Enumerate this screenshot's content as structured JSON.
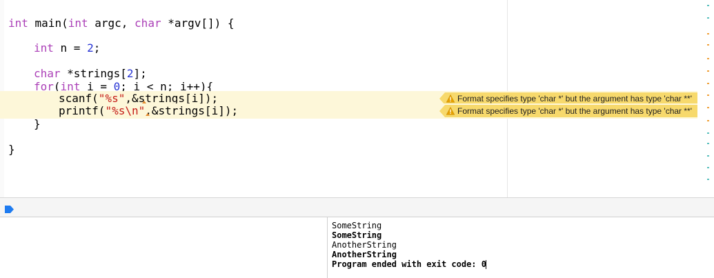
{
  "editor": {
    "code_lines": [
      {
        "segments": [
          {
            "t": "int",
            "c": "kw"
          },
          {
            "t": " main(",
            "c": ""
          },
          {
            "t": "int",
            "c": "kw"
          },
          {
            "t": " argc, ",
            "c": ""
          },
          {
            "t": "char",
            "c": "kw"
          },
          {
            "t": " *argv[]) {",
            "c": ""
          }
        ]
      },
      {
        "segments": [
          {
            "t": "int",
            "c": "kw"
          },
          {
            "t": " n = ",
            "c": ""
          },
          {
            "t": "2",
            "c": "num"
          },
          {
            "t": ";",
            "c": ""
          }
        ]
      },
      {
        "segments": [
          {
            "t": "char",
            "c": "kw"
          },
          {
            "t": " *strings[",
            "c": ""
          },
          {
            "t": "2",
            "c": "num"
          },
          {
            "t": "];",
            "c": ""
          }
        ]
      },
      {
        "segments": [
          {
            "t": "for",
            "c": "kw"
          },
          {
            "t": "(",
            "c": ""
          },
          {
            "t": "int",
            "c": "kw"
          },
          {
            "t": " i = ",
            "c": ""
          },
          {
            "t": "0",
            "c": "num"
          },
          {
            "t": "; i < n; i++){",
            "c": ""
          }
        ]
      },
      {
        "segments": [
          {
            "t": "scanf(",
            "c": ""
          },
          {
            "t": "\"%s\"",
            "c": "str"
          },
          {
            "t": ",&strings[i]);",
            "c": ""
          }
        ]
      },
      {
        "segments": [
          {
            "t": "printf(",
            "c": ""
          },
          {
            "t": "\"%s\\n\"",
            "c": "str"
          },
          {
            "t": ",&strings[i]);",
            "c": ""
          }
        ]
      },
      {
        "segments": [
          {
            "t": "}",
            "c": ""
          }
        ]
      },
      {
        "segments": [
          {
            "t": "}",
            "c": ""
          }
        ]
      }
    ],
    "warnings": [
      {
        "icon": "warning-triangle-icon",
        "message": "Format specifies type 'char *' but the argument has type 'char **'"
      },
      {
        "icon": "warning-triangle-icon",
        "message": "Format specifies type 'char *' but the argument has type 'char **'"
      }
    ]
  },
  "debug_bar": {
    "continue_icon": "continue-execution-icon"
  },
  "console": {
    "lines": [
      {
        "text": "SomeString",
        "bold": false
      },
      {
        "text": "SomeString",
        "bold": true
      },
      {
        "text": "AnotherString",
        "bold": false
      },
      {
        "text": "AnotherString",
        "bold": true
      },
      {
        "text": "Program ended with exit code: 0",
        "bold": true
      }
    ]
  },
  "colors": {
    "keyword": "#ab3fb7",
    "number": "#2734d4",
    "string": "#c41a16",
    "warning_badge": "#f7d96c",
    "warning_line": "#fdf7d9",
    "debug_accent": "#1e7bf0"
  }
}
